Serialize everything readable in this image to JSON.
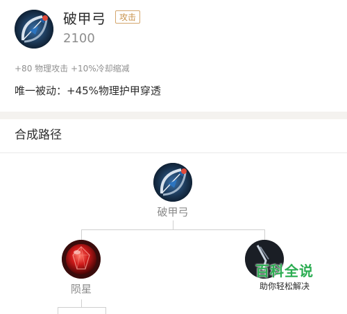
{
  "item": {
    "name": "破甲弓",
    "tag": "攻击",
    "price": "2100",
    "stats": "+80 物理攻击 +10%冷却缩减",
    "passive": "唯一被动：+45%物理护甲穿透",
    "icon": "bow-item-icon"
  },
  "recipe": {
    "title": "合成路径",
    "root": {
      "label": "破甲弓",
      "icon": "bow-item-icon"
    },
    "children": [
      {
        "label": "陨星",
        "icon": "red-gem-item-icon"
      },
      {
        "label": "",
        "icon": "dark-blade-item-icon"
      }
    ]
  },
  "watermark": {
    "title": "百科全说",
    "subtitle": "助你轻松解决"
  },
  "colors": {
    "tag": "#c8924a",
    "section_gap": "#f4f2ef",
    "watermark": "#2cad52"
  }
}
